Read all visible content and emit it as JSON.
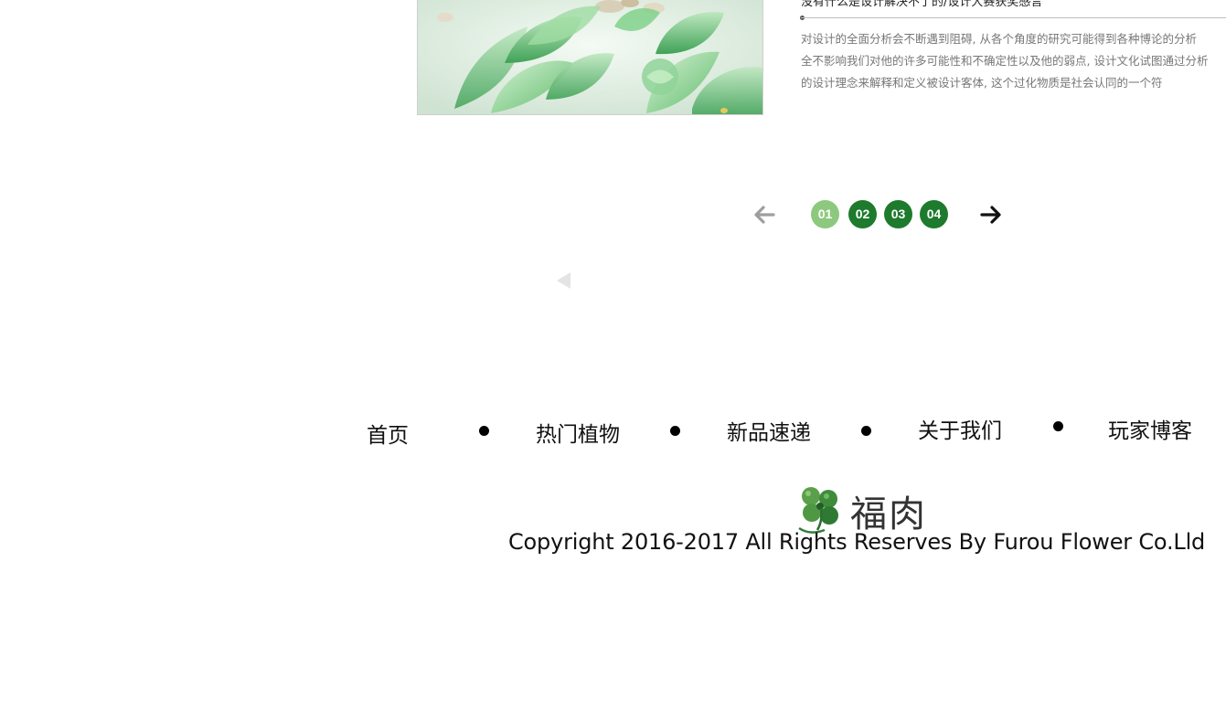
{
  "article": {
    "title": "没有什么是设计解决不了的/设计大赛获奖感言",
    "excerpt_lines": [
      "对设计的全面分析会不断遇到阻碍, 从各个角度的研究可能得到各种博论的分析",
      "全不影响我们对他的许多可能性和不确定性以及他的弱点, 设计文化试图通过分析",
      "的设计理念来解释和定义被设计客体, 这个过化物质是社会认同的一个符"
    ]
  },
  "pager": {
    "prev_icon": "arrow-left-icon",
    "next_icon": "arrow-right-icon",
    "pages": [
      "01",
      "02",
      "03",
      "04"
    ],
    "active_page": "01",
    "colors": {
      "active": "#8cc97e",
      "inactive": "#1e7a2c",
      "prev_arrow": "#9e9e9e",
      "next_arrow": "#111111"
    }
  },
  "footer_nav": {
    "items": [
      "首页",
      "热门植物",
      "新品速递",
      "关于我们",
      "玩家博客"
    ]
  },
  "brand": {
    "logo_text": "福肉",
    "logo_icon": "clover-icon",
    "copyright": "Copyright 2016-2017 All Rights Reserves By Furou Flower Co.Lld"
  }
}
